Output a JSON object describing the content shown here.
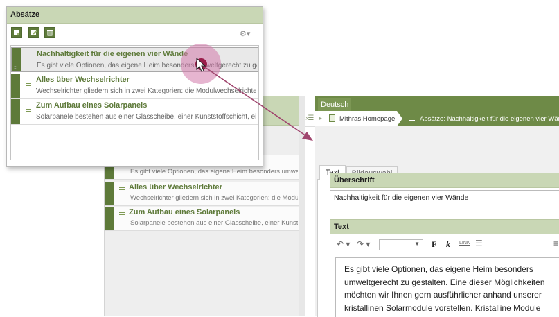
{
  "popup": {
    "title": "Absätze",
    "toolbar_icons": [
      "new-icon",
      "edit-icon",
      "delete-icon"
    ],
    "settings_label": "⚙▾",
    "items": [
      {
        "title": "Nachhaltigkeit für die eigenen vier Wände",
        "snippet": "Es gibt viele Optionen, das eigene Heim besonders umweltgerecht zu gestalten.",
        "selected": true
      },
      {
        "title": "Alles über Wechselrichter",
        "snippet": "Wechselrichter gliedern sich in zwei Kategorien: die Modulwechselrichter",
        "selected": false
      },
      {
        "title": "Zum Aufbau eines Solarpanels",
        "snippet": "Solarpanele bestehen aus einer Glasscheibe, einer Kunststoffschicht, einer",
        "selected": false
      }
    ]
  },
  "background_list": {
    "items": [
      {
        "title": "nde",
        "snippet": "Es gibt viele Optionen, das eigene Heim besonders umweltgerecht"
      },
      {
        "title": "Alles über Wechselrichter",
        "snippet": "Wechselrichter gliedern sich in zwei Kategorien: die Modulwechselrichter"
      },
      {
        "title": "Zum Aufbau eines Solarpanels",
        "snippet": "Solarpanele bestehen aus einer Glasscheibe, einer Kunststoffschicht"
      }
    ]
  },
  "editor": {
    "language_tab": "Deutsch",
    "breadcrumb": {
      "page": "Mithras Homepage",
      "paragraph": "Absätze: Nachhaltigkeit für die eigenen vier Wände"
    },
    "tabs": [
      "Text",
      "Bildauswahl"
    ],
    "heading_label": "Überschrift",
    "heading_value": "Nachhaltigkeit für die eigenen vier Wände",
    "text_label": "Text",
    "toolbar": {
      "undo": "↶ ▾",
      "redo": "↷ ▾",
      "bold": "F",
      "italic": "k",
      "link": "LINK",
      "list": "☰"
    },
    "text_lines": [
      "Es gibt viele Optionen, das eigene Heim besonders",
      "umweltgerecht zu gestalten. Eine dieser Möglichkeiten",
      "möchten wir Ihnen gern ausführlicher anhand unserer",
      "kristallinen Solarmodule vorstellen. Kristalline Module"
    ]
  }
}
